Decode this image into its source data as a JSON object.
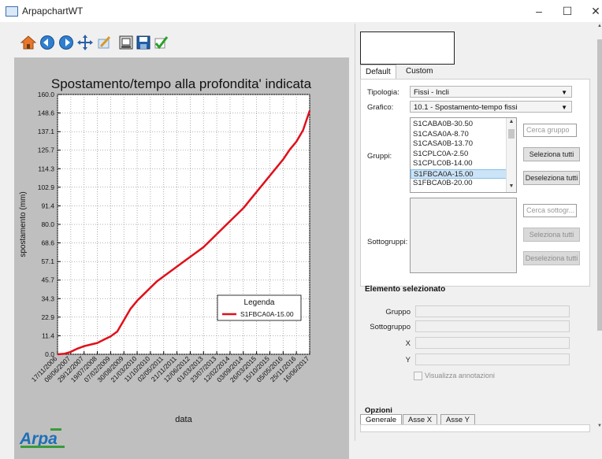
{
  "window": {
    "title": "ArpapchartWT",
    "minimize": "–",
    "maximize": "☐",
    "close": "✕"
  },
  "toolbar": {
    "icons": [
      "home-icon",
      "back-icon",
      "forward-icon",
      "pan-icon",
      "zoom-icon",
      "configure-subplots-icon",
      "save-icon",
      "checkmark-icon"
    ]
  },
  "chart_data": {
    "type": "line",
    "title": "Spostamento/tempo alla profondita' indicata",
    "xlabel": "data",
    "ylabel": "spostamento (mm)",
    "ylim": [
      0.0,
      160.0
    ],
    "y_ticks": [
      "0.0",
      "11.4",
      "22.9",
      "34.3",
      "45.7",
      "57.1",
      "68.6",
      "80.0",
      "91.4",
      "102.9",
      "114.3",
      "125.7",
      "137.1",
      "148.6",
      "160.0"
    ],
    "x_ticks": [
      "17/11/2006",
      "08/06/2007",
      "29/12/2007",
      "19/07/2008",
      "07/02/2009",
      "30/08/2009",
      "21/03/2010",
      "11/10/2010",
      "02/05/2011",
      "21/11/2011",
      "12/06/2012",
      "01/03/2013",
      "23/07/2013",
      "12/02/2014",
      "03/09/2014",
      "26/03/2015",
      "15/10/2015",
      "05/05/2016",
      "25/11/2016",
      "16/06/2017"
    ],
    "grid": true,
    "legend": {
      "title": "Legenda",
      "position": "lower-right"
    },
    "series": [
      {
        "name": "S1FBCA0A-15.00",
        "color": "#e0101a",
        "x": [
          0,
          0.5,
          1,
          1.5,
          2,
          2.5,
          3,
          3.5,
          4,
          4.5,
          5,
          5.5,
          6,
          6.5,
          7,
          7.5,
          8,
          8.5,
          9,
          9.5,
          10,
          10.5,
          11,
          11.5,
          12,
          12.5,
          13,
          13.5,
          14,
          14.5,
          15,
          15.5,
          16,
          16.5,
          17,
          17.5,
          18,
          18.5,
          19
        ],
        "y": [
          0,
          0.3,
          1.5,
          3.5,
          5,
          6,
          7,
          9,
          11,
          14,
          21,
          28,
          33,
          37,
          41,
          45,
          48,
          51,
          54,
          57,
          60,
          63,
          66,
          70,
          74,
          78,
          82,
          86,
          90,
          95,
          100,
          105,
          110,
          115,
          120,
          126,
          131,
          138,
          150
        ]
      }
    ]
  },
  "logo": {
    "text": "Arpa"
  },
  "right_panel": {
    "tabs": [
      "Default",
      "Custom"
    ],
    "tipologia": {
      "label": "Tipologia:",
      "value": "Fissi - Incli"
    },
    "grafico": {
      "label": "Grafico:",
      "value": "10.1 - Spostamento-tempo fissi"
    },
    "gruppi": {
      "label": "Gruppi:",
      "items": [
        "S1CABA0B-30.50",
        "S1CASA0A-8.70",
        "S1CASA0B-13.70",
        "S1CPLC0A-2.50",
        "S1CPLC0B-14.00",
        "S1FBCA0A-15.00",
        "S1FBCA0B-20.00"
      ],
      "selected_index": 5,
      "search_placeholder": "Cerca gruppo",
      "select_all": "Seleziona tutti",
      "deselect_all": "Deseleziona tutti"
    },
    "sottogruppi": {
      "label": "Sottogruppi:",
      "search_placeholder": "Cerca sottogr...",
      "select_all": "Seleziona tutti",
      "deselect_all": "Deseleziona tutti"
    },
    "elemento": {
      "title": "Elemento selezionato",
      "gruppo": "Gruppo",
      "sottogruppo": "Sottogruppo",
      "x": "X",
      "y": "Y",
      "annotazioni": "Visualizza annotazioni"
    },
    "opzioni": {
      "title": "Opzioni",
      "tabs": [
        "Generale",
        "Asse X",
        "Asse Y"
      ]
    }
  }
}
